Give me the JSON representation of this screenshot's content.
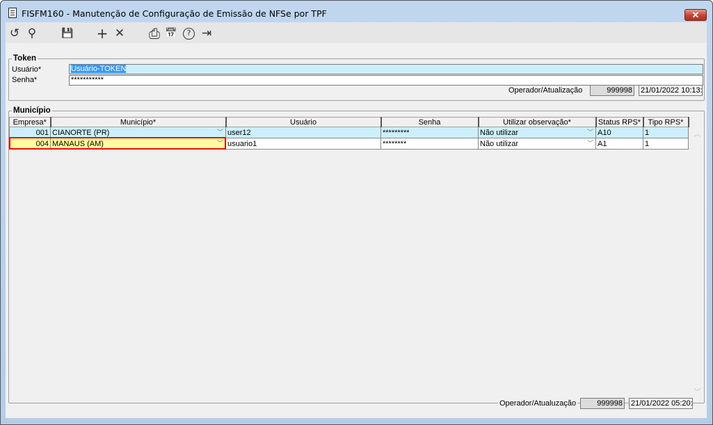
{
  "window": {
    "title": "FISFM160 - Manutenção de Configuração de Emissão de NFSe por TPF",
    "close_label": "✕"
  },
  "toolbar": [
    {
      "name": "refresh-icon",
      "glyph": "↺"
    },
    {
      "name": "search-icon",
      "glyph": "⚲"
    },
    {
      "name": "save-icon",
      "glyph": "💾"
    },
    {
      "name": "add-icon",
      "glyph": "+"
    },
    {
      "name": "delete-icon",
      "glyph": "✕"
    },
    {
      "name": "print-icon",
      "glyph": "⎙"
    },
    {
      "name": "calendar-icon",
      "glyph": "📅"
    },
    {
      "name": "help-icon",
      "glyph": "?"
    },
    {
      "name": "exit-icon",
      "glyph": "⇥"
    }
  ],
  "token": {
    "legend": "Token",
    "usuario_label": "Usuário*",
    "usuario_value": "Usuário-TOKEN",
    "senha_label": "Senha*",
    "senha_value": "***********",
    "operador_label": "Operador/Atualização",
    "operador": "999998",
    "atualizacao": "21/01/2022 10:13:"
  },
  "municipio": {
    "legend": "Município",
    "columns": [
      "Empresa*",
      "Município*",
      "Usuário",
      "Senha",
      "Utilizar observação*",
      "Status RPS*",
      "Tipo RPS*"
    ],
    "rows": [
      {
        "empresa": "001",
        "municipio": "CIANORTE (PR)",
        "usuario": "user12",
        "senha": "*********",
        "obs": "Não utilizar",
        "status": "A10",
        "tipo": "1"
      },
      {
        "empresa": "004",
        "municipio": "MANAUS (AM)",
        "usuario": "usuario1",
        "senha": "********",
        "obs": "Não utilizar",
        "status": "A1",
        "tipo": "1"
      }
    ],
    "operador_label": "Operador/Atualuzação",
    "operador": "999998",
    "atualizacao": "21/01/2022 05:20:"
  },
  "colors": {
    "selected_row": "#cdeffd",
    "current_row": "#ffff9e",
    "focus_border": "#e81010"
  }
}
